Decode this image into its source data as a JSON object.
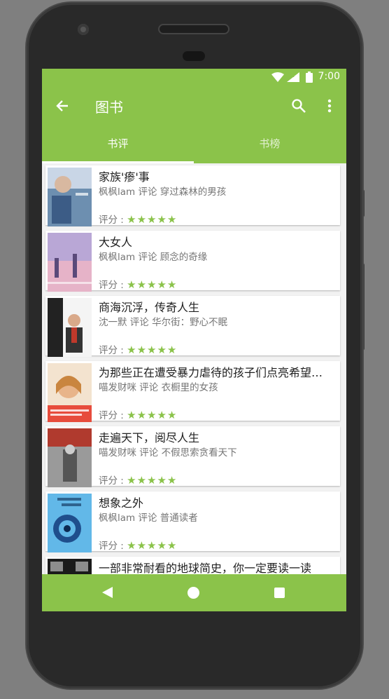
{
  "status": {
    "time": "7:00"
  },
  "appbar": {
    "title": "图书"
  },
  "tabs": [
    {
      "label": "书评"
    },
    {
      "label": "书榜"
    }
  ],
  "reviews": [
    {
      "title": "家族'瘆'事",
      "meta": "枫枫lam 评论 穿过森林的男孩",
      "rating_label": "评分 :",
      "stars": 5
    },
    {
      "title": "大女人",
      "meta": "枫枫lam 评论 顾念的奇缘",
      "rating_label": "评分 :",
      "stars": 5
    },
    {
      "title": "商海沉浮，传奇人生",
      "meta": "沈一默 评论 华尔街：野心不眠",
      "rating_label": "评分 :",
      "stars": 5
    },
    {
      "title": "为那些正在遭受暴力虐待的孩子们点亮希望…",
      "meta": "喵发财咪 评论 衣橱里的女孩",
      "rating_label": "评分 :",
      "stars": 5
    },
    {
      "title": "走遍天下，阅尽人生",
      "meta": "喵发财咪 评论 不假思索贪看天下",
      "rating_label": "评分 :",
      "stars": 5
    },
    {
      "title": "想象之外",
      "meta": "枫枫lam 评论 普通读者",
      "rating_label": "评分 :",
      "stars": 5
    },
    {
      "title": "一部非常耐看的地球简史，你一定要读一读",
      "meta": "",
      "rating_label": "",
      "stars": 0
    }
  ],
  "covers": [
    {
      "text": "穿过森林的男孩",
      "color": "#6d8fb0"
    },
    {
      "text": "顾念的奇缘",
      "color": "#b9a7d6"
    },
    {
      "text": "华尔街：野心不眠",
      "color": "#f4f4f4"
    },
    {
      "text": "衣橱里的女孩",
      "color": "#f3e3cf"
    },
    {
      "text": "不假思索贪看天下",
      "color": "#9a9a9a"
    },
    {
      "text": "普通读者",
      "color": "#62b8e8"
    },
    {
      "text": "地球",
      "color": "#1b1b1b"
    }
  ],
  "colors": {
    "accent": "#8bc34a"
  }
}
